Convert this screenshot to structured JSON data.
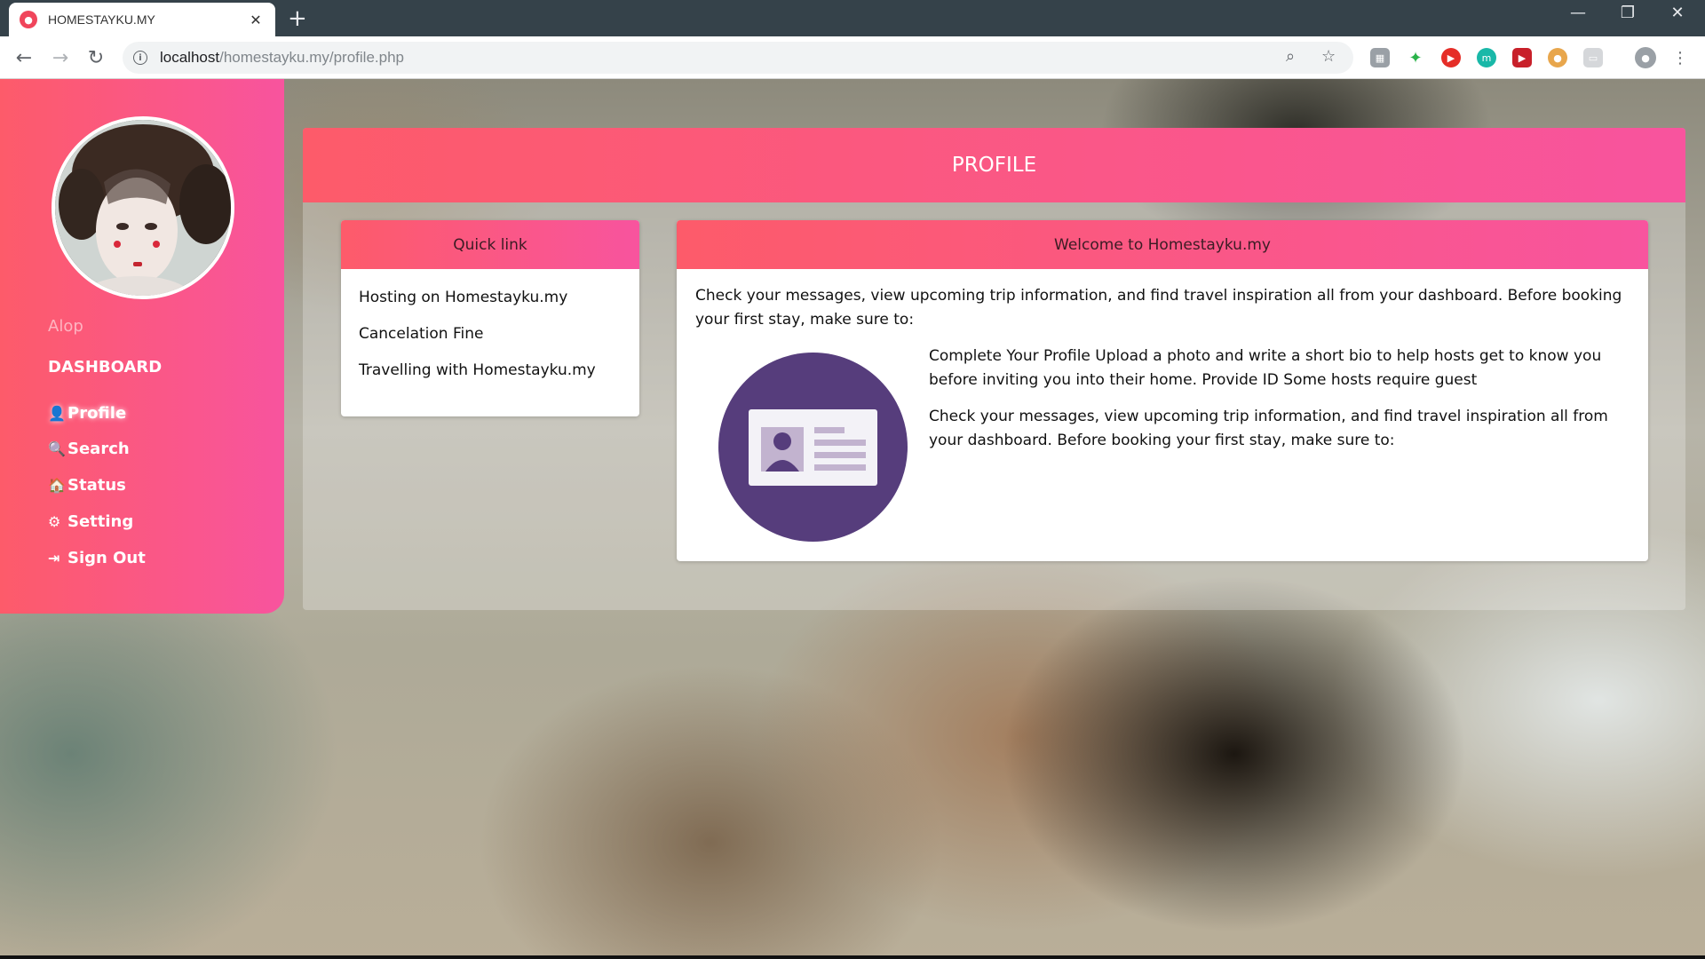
{
  "browser": {
    "tab_title": "HOMESTAYKU.MY",
    "url_host": "localhost",
    "url_path": "/homestayku.my/profile.php"
  },
  "sidebar": {
    "username": "Alop",
    "heading": "DASHBOARD",
    "items": [
      {
        "label": "Profile",
        "icon": "user-icon",
        "glyph": "👤"
      },
      {
        "label": "Search",
        "icon": "search-icon",
        "glyph": "🔍"
      },
      {
        "label": "Status",
        "icon": "home-icon",
        "glyph": "🏠"
      },
      {
        "label": "Setting",
        "icon": "gear-icon",
        "glyph": "⚙"
      },
      {
        "label": "Sign Out",
        "icon": "sign-out-icon",
        "glyph": "⇥"
      }
    ]
  },
  "main": {
    "title": "PROFILE",
    "quick_links": {
      "title": "Quick link",
      "links": [
        "Hosting on Homestayku.my",
        "Cancelation Fine",
        "Travelling with Homestayku.my"
      ]
    },
    "welcome": {
      "title": "Welcome to Homestayku.my",
      "intro": "Check your messages, view upcoming trip information, and find travel inspiration all from your dashboard. Before booking your first stay, make sure to:",
      "paragraph1": "Complete Your Profile Upload a photo and write a short bio to help hosts get to know you before inviting you into their home. Provide ID Some hosts require guest",
      "paragraph2": "Check your messages, view upcoming trip information, and find travel inspiration all from your dashboard. Before booking your first stay, make sure to:"
    }
  },
  "colors": {
    "accent_start": "#fd5b6a",
    "accent_end": "#f8549e",
    "illustration_circle": "#563d7c"
  }
}
